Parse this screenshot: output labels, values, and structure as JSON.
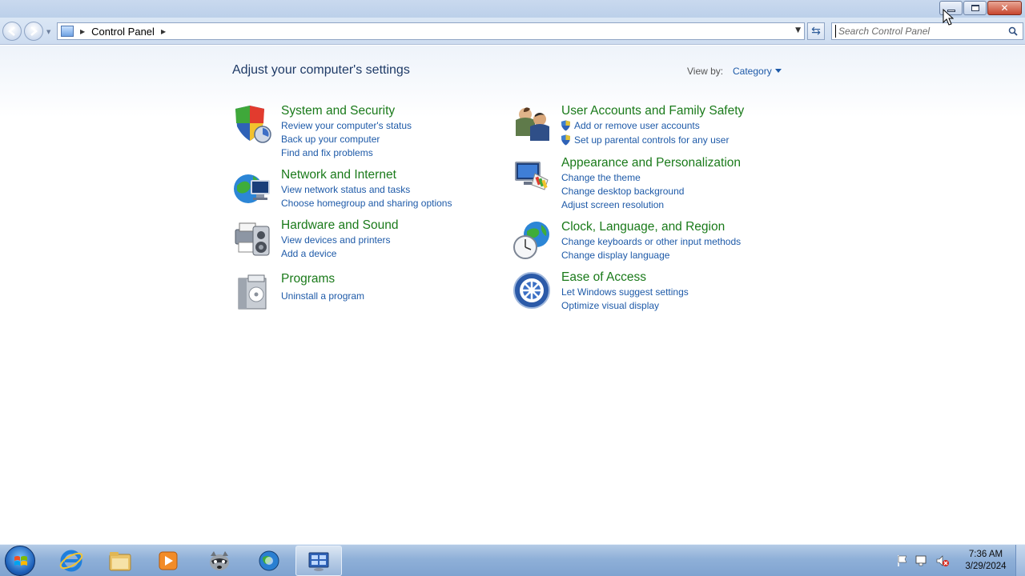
{
  "window": {
    "caption_buttons": [
      "minimize",
      "restore",
      "close"
    ]
  },
  "navbar": {
    "breadcrumb": "Control Panel",
    "search_placeholder": "Search Control Panel"
  },
  "page": {
    "title": "Adjust your computer's settings",
    "view_by_label": "View by:",
    "view_by_value": "Category"
  },
  "categories": [
    {
      "title": "System and Security",
      "icon": "shield-security-icon",
      "links": [
        "Review your computer's status",
        "Back up your computer",
        "Find and fix problems"
      ]
    },
    {
      "title": "Network and Internet",
      "icon": "network-globe-icon",
      "links": [
        "View network status and tasks",
        "Choose homegroup and sharing options"
      ]
    },
    {
      "title": "Hardware and Sound",
      "icon": "printer-speaker-icon",
      "links": [
        "View devices and printers",
        "Add a device"
      ]
    },
    {
      "title": "Programs",
      "icon": "programs-box-icon",
      "links": [
        "Uninstall a program"
      ]
    },
    {
      "title": "User Accounts and Family Safety",
      "icon": "users-icon",
      "links": [
        "Add or remove user accounts",
        "Set up parental controls for any user"
      ]
    },
    {
      "title": "Appearance and Personalization",
      "icon": "monitor-palette-icon",
      "links": [
        "Change the theme",
        "Change desktop background",
        "Adjust screen resolution"
      ]
    },
    {
      "title": "Clock, Language, and Region",
      "icon": "clock-globe-icon",
      "links": [
        "Change keyboards or other input methods",
        "Change display language"
      ]
    },
    {
      "title": "Ease of Access",
      "icon": "ease-of-access-icon",
      "links": [
        "Let Windows suggest settings",
        "Optimize visual display"
      ]
    }
  ],
  "taskbar": {
    "items": [
      "start-orb",
      "internet-explorer",
      "windows-explorer",
      "media-player",
      "raccoon-app",
      "chrome-like-browser",
      "control-panel"
    ],
    "clock_time": "7:36 AM",
    "clock_date": "3/29/2024"
  }
}
